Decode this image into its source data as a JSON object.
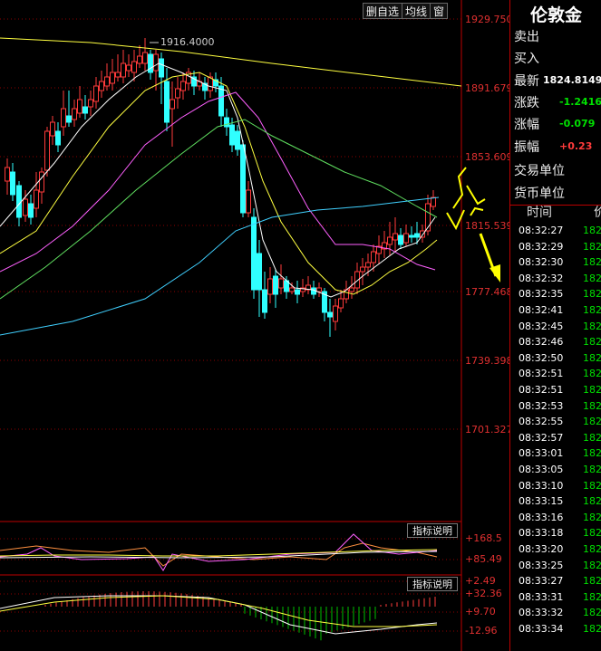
{
  "toolbar": {
    "items": [
      {
        "label": "删自选",
        "name": "remove-watchlist-button"
      },
      {
        "label": "均线",
        "name": "moving-average-button"
      },
      {
        "label": "窗",
        "name": "window-button"
      }
    ]
  },
  "price_axis": {
    "labels": [
      "1929.750",
      "1891.679",
      "1853.609",
      "1815.539",
      "1777.468",
      "1739.398",
      "1701.327"
    ],
    "high_annotation": "1916.4000"
  },
  "indicator1": {
    "button_label": "指标说明",
    "labels": [
      "+168.5",
      "+85.49",
      "+2.49"
    ]
  },
  "indicator2": {
    "button_label": "指标说明",
    "labels": [
      "+32.36",
      "+9.70",
      "-12.96"
    ]
  },
  "colors": {
    "up": "#ff3b3b",
    "down": "#30ffff",
    "yellow_line": "#ffff40",
    "white_line": "#ffffff",
    "magenta_line": "#ff60ff",
    "green_line": "#60e060",
    "cyan_line": "#40d0ff",
    "grid": "#8b0000",
    "arrows": "#ffff00"
  },
  "panel": {
    "title": "伦敦金",
    "rows": [
      {
        "label": "卖出",
        "value": "",
        "color": "#fff"
      },
      {
        "label": "买入",
        "value": "",
        "color": "#fff"
      },
      {
        "label": "最新",
        "value": "1824.8149",
        "color": "#fff"
      },
      {
        "label": "涨跌",
        "value": "-1.2416",
        "color": "#00e000"
      },
      {
        "label": "涨幅",
        "value": "-0.079",
        "color": "#00e000"
      },
      {
        "label": "振幅",
        "value": "+0.23",
        "color": "#ff3b3b"
      },
      {
        "label": "交易单位",
        "value": "",
        "color": "#fff"
      },
      {
        "label": "货币单位",
        "value": "",
        "color": "#fff"
      }
    ],
    "tick_header": {
      "time": "时间",
      "price": "价"
    },
    "ticks": [
      [
        "08:32:27",
        "182"
      ],
      [
        "08:32:29",
        "182"
      ],
      [
        "08:32:30",
        "182"
      ],
      [
        "08:32:32",
        "182"
      ],
      [
        "08:32:35",
        "182"
      ],
      [
        "08:32:41",
        "182"
      ],
      [
        "08:32:45",
        "182"
      ],
      [
        "08:32:46",
        "182"
      ],
      [
        "08:32:50",
        "182"
      ],
      [
        "08:32:51",
        "182"
      ],
      [
        "08:32:51",
        "182"
      ],
      [
        "08:32:53",
        "182"
      ],
      [
        "08:32:55",
        "182"
      ],
      [
        "08:32:57",
        "182"
      ],
      [
        "08:33:01",
        "182"
      ],
      [
        "08:33:05",
        "182"
      ],
      [
        "08:33:10",
        "182"
      ],
      [
        "08:33:15",
        "182"
      ],
      [
        "08:33:16",
        "182"
      ],
      [
        "08:33:18",
        "182"
      ],
      [
        "08:33:20",
        "182"
      ],
      [
        "08:33:25",
        "182"
      ],
      [
        "08:33:27",
        "182"
      ],
      [
        "08:33:31",
        "182"
      ],
      [
        "08:33:32",
        "182"
      ],
      [
        "08:33:34",
        "182"
      ]
    ]
  }
}
